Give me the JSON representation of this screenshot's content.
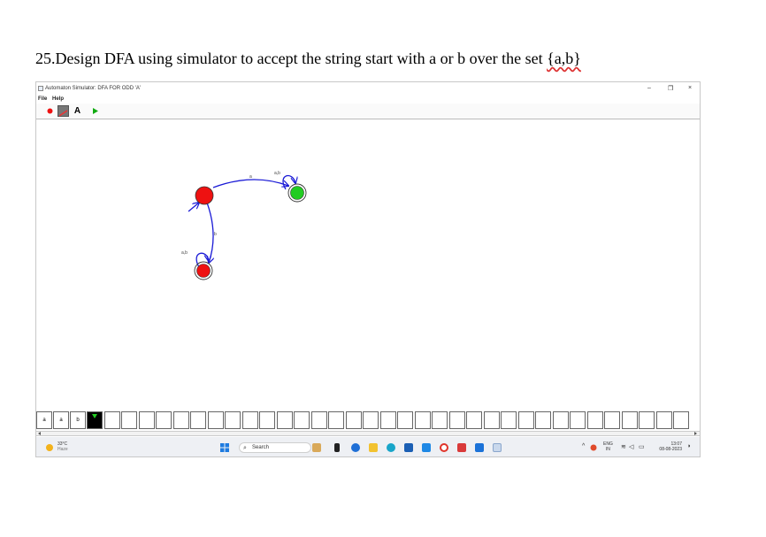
{
  "document": {
    "heading": "25.Design DFA using simulator to accept the string start with a or b over the set ",
    "heading_set": "{a,b}"
  },
  "window": {
    "title": "Automaton Simulator: DFA FOR ODD 'A'",
    "minimize": "–",
    "maximize": "❐",
    "close": "×"
  },
  "menu": {
    "file": "File",
    "help": "Help"
  },
  "toolbar": {
    "text_tool": "A"
  },
  "automaton": {
    "edge_q0_q1": "a",
    "edge_q0_q2": "b",
    "loop_q1": "a,b",
    "loop_q2": "a,b",
    "colors": {
      "start_state": "#ee1111",
      "accept_state": "#22cc22",
      "edge": "#1a1ad6"
    }
  },
  "tape": {
    "cells": [
      "a",
      "a",
      "b"
    ]
  },
  "taskbar": {
    "temperature": "33°C",
    "weather": "Haze",
    "search": "Search",
    "lang": "ENG",
    "region": "IN",
    "time": "13:07",
    "date": "08-08-2023"
  }
}
